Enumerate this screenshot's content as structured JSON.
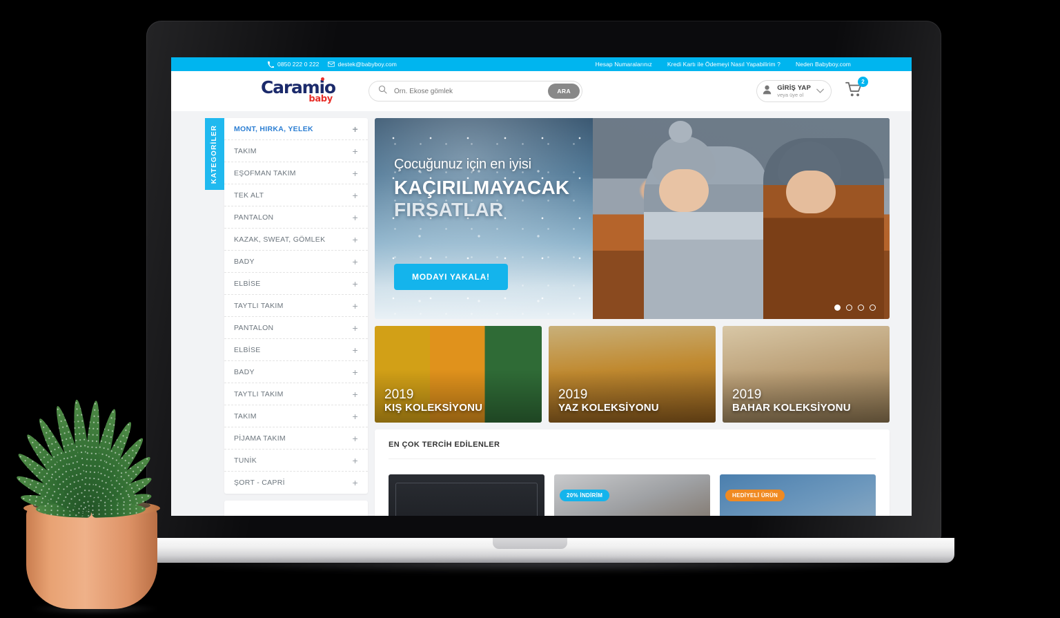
{
  "topbar": {
    "phone": "0850 222 0 222",
    "email": "destek@babyboy.com",
    "phone_icon": "phone-icon",
    "email_icon": "envelope-icon",
    "links": [
      "Hesap Numaralarınız",
      "Kredi Kartı ile Ödemeyi Nasıl Yapabilirim ?",
      "Neden Babyboy.com"
    ]
  },
  "header": {
    "logo_main": "Caramio",
    "logo_sub": "baby",
    "search": {
      "placeholder": "Örn. Ekose gömlek",
      "value": "",
      "button_label": "ARA",
      "icon": "search-icon"
    },
    "account": {
      "title": "GİRİŞ YAP",
      "subtitle": "veya üye ol",
      "icon": "user-icon",
      "chevron": "chevron-down-icon"
    },
    "cart": {
      "icon": "cart-icon",
      "count": "2"
    }
  },
  "sidebar": {
    "tab_label": "KATEGORİLER",
    "expand_symbol": "+",
    "items": [
      {
        "label": "MONT, HIRKA, YELEK",
        "active": true
      },
      {
        "label": "TAKIM",
        "active": false
      },
      {
        "label": "EŞOFMAN TAKIM",
        "active": false
      },
      {
        "label": "TEK ALT",
        "active": false
      },
      {
        "label": "PANTALON",
        "active": false
      },
      {
        "label": "KAZAK, SWEAT, GÖMLEK",
        "active": false
      },
      {
        "label": "BADY",
        "active": false
      },
      {
        "label": "ELBİSE",
        "active": false
      },
      {
        "label": "TAYTLI TAKIM",
        "active": false
      },
      {
        "label": "PANTALON",
        "active": false
      },
      {
        "label": "ELBİSE",
        "active": false
      },
      {
        "label": "BADY",
        "active": false
      },
      {
        "label": "TAYTLI TAKIM",
        "active": false
      },
      {
        "label": "TAKIM",
        "active": false
      },
      {
        "label": "PİJAMA TAKIM",
        "active": false
      },
      {
        "label": "TUNİK",
        "active": false
      },
      {
        "label": "ŞORT - CAPRİ",
        "active": false
      }
    ]
  },
  "hero": {
    "subtitle": "Çocuğunuz için en iyisi",
    "title_line1": "KAÇIRILMAYACAK",
    "title_line2": "FIRSATLAR",
    "cta_label": "MODAYI YAKALA!",
    "slides_total": 4,
    "active_slide": 1
  },
  "collections": [
    {
      "year": "2019",
      "name": "KIŞ KOLEKSİYONU"
    },
    {
      "year": "2019",
      "name": "YAZ KOLEKSİYONU"
    },
    {
      "year": "2019",
      "name": "BAHAR KOLEKSİYONU"
    }
  ],
  "products": {
    "section_title": "EN ÇOK TERCİH EDİLENLER",
    "cards": [
      {
        "badge": ""
      },
      {
        "badge": "20% İNDİRİM"
      },
      {
        "badge": "HEDİYELİ ÜRÜN"
      }
    ]
  },
  "colors": {
    "accent": "#00b5ef",
    "cta": "#14b4ec",
    "logo_navy": "#1b2a6b",
    "logo_red": "#e8302a",
    "badge_orange": "#f08a22",
    "page_bg": "#f2f3f5"
  }
}
